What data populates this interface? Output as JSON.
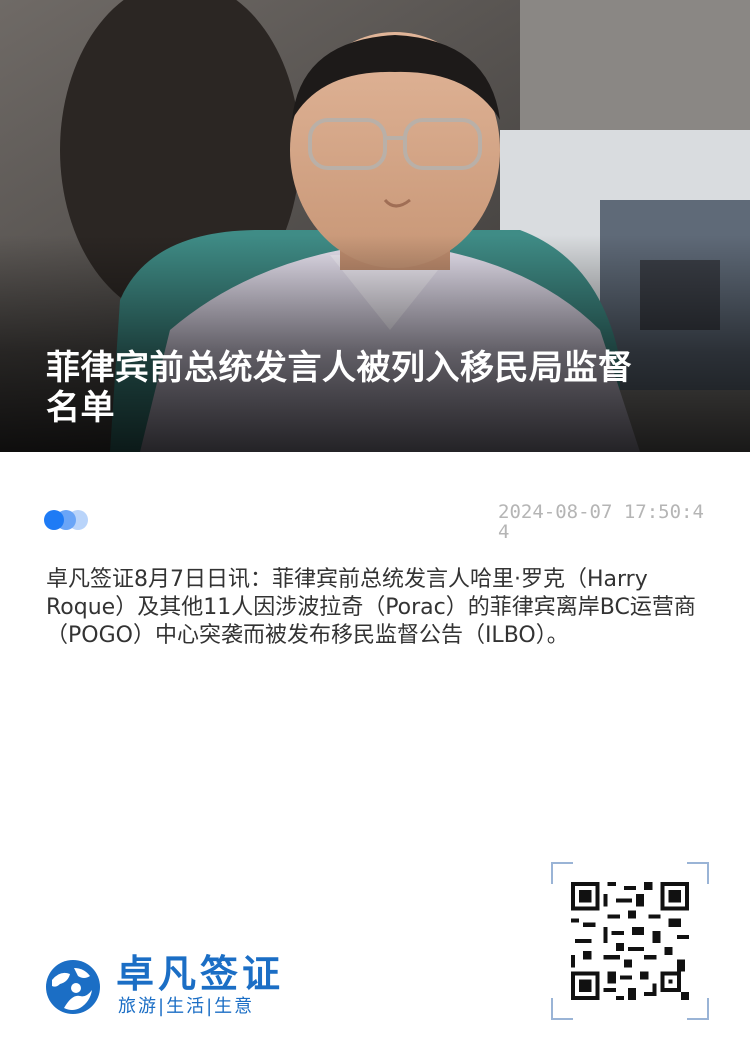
{
  "hero": {
    "title": "菲律宾前总统发言人被列入移民局监督名单"
  },
  "meta": {
    "timestamp": "2024-08-07 17:50:44"
  },
  "article": {
    "body": "卓凡签证8月7日日讯：菲律宾前总统发言人哈里·罗克（Harry Roque）及其他11人因涉波拉奇（Porac）的菲律宾离岸BC运营商（POGO）中心突袭而被发布移民监督公告（ILBO）。"
  },
  "brand": {
    "name": "卓凡签证",
    "slogan": "旅游|生活|生意"
  },
  "colors": {
    "accent": "#1e7bf5",
    "brand": "#1b6ec5",
    "timestamp": "#b5b5b5"
  },
  "icons": {
    "logo": "globe-person-logo",
    "qr": "qr-code"
  }
}
